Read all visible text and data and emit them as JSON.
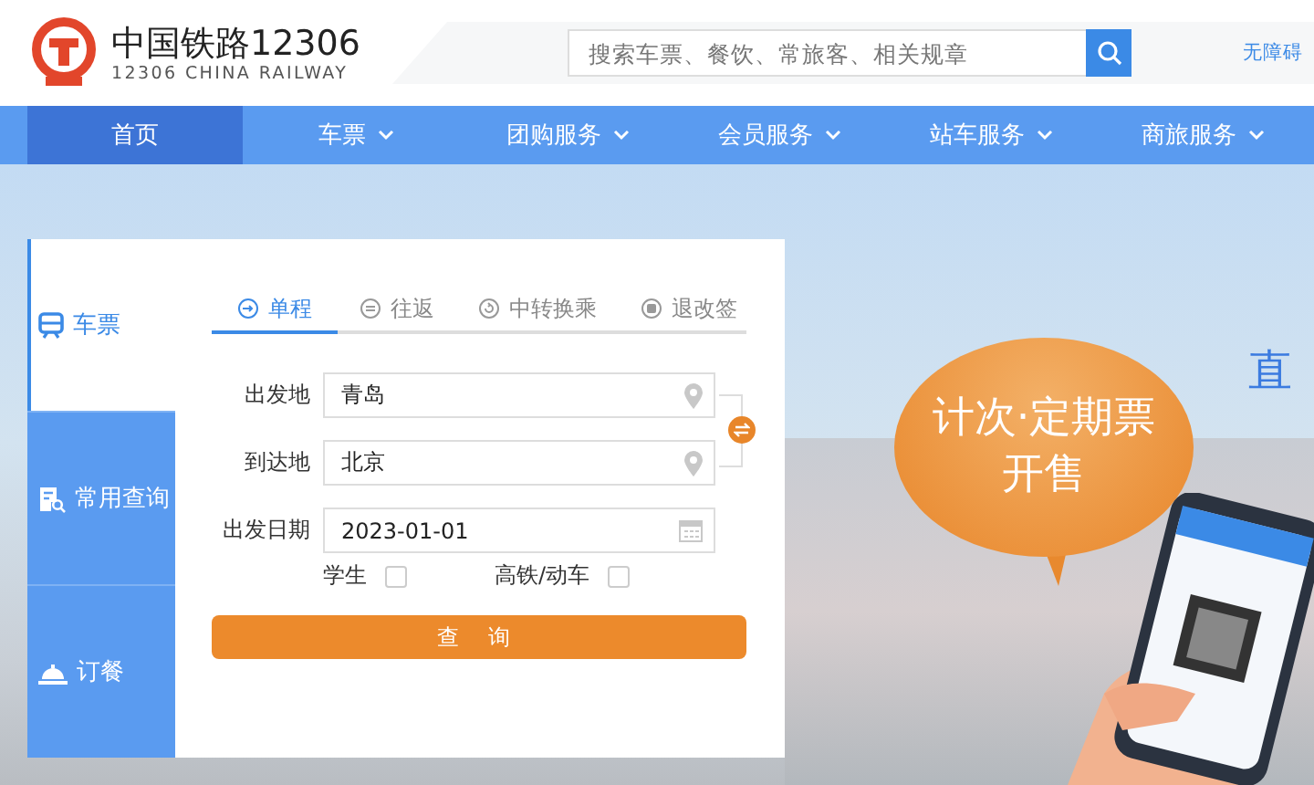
{
  "header": {
    "logo_title": "中国铁路12306",
    "logo_subtitle": "12306 CHINA RAILWAY",
    "search": {
      "placeholder": "搜索车票、餐饮、常旅客、相关规章"
    },
    "accessibility_link": "无障碍"
  },
  "nav": [
    {
      "label": "首页",
      "selected": true,
      "has_menu": false
    },
    {
      "label": "车票",
      "selected": false,
      "has_menu": true
    },
    {
      "label": "团购服务",
      "selected": false,
      "has_menu": true
    },
    {
      "label": "会员服务",
      "selected": false,
      "has_menu": true
    },
    {
      "label": "站车服务",
      "selected": false,
      "has_menu": true
    },
    {
      "label": "商旅服务",
      "selected": false,
      "has_menu": true
    }
  ],
  "booking": {
    "side_tabs": [
      {
        "label": "车票",
        "selected": true
      },
      {
        "label": "常用查询",
        "selected": false
      },
      {
        "label": "订餐",
        "selected": false
      }
    ],
    "trip_tabs": [
      {
        "label": "单程",
        "selected": true
      },
      {
        "label": "往返",
        "selected": false
      },
      {
        "label": "中转换乘",
        "selected": false
      },
      {
        "label": "退改签",
        "selected": false
      }
    ],
    "fields": [
      {
        "label": "出发地",
        "value": "青岛",
        "kind": "location"
      },
      {
        "label": "到达地",
        "value": "北京",
        "kind": "location"
      },
      {
        "label": "出发日期",
        "value": "2023-01-01",
        "kind": "date"
      }
    ],
    "options": [
      {
        "label": "学生",
        "checked": false
      },
      {
        "label": "高铁/动车",
        "checked": false
      }
    ],
    "search_button": "查 询"
  },
  "banner": {
    "bubble_lines": [
      "计次·定期票",
      "开售"
    ],
    "side_text": "直"
  }
}
